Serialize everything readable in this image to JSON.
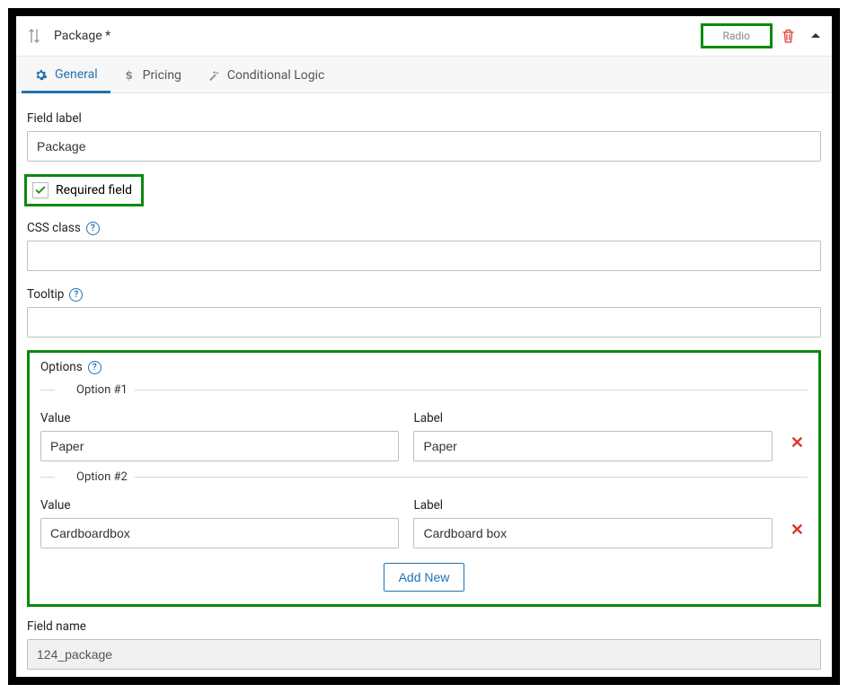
{
  "header": {
    "title": "Package *",
    "type_label": "Radio"
  },
  "tabs": {
    "general": "General",
    "pricing": "Pricing",
    "conditional": "Conditional Logic"
  },
  "general": {
    "field_label_label": "Field label",
    "field_label_value": "Package",
    "required_label": "Required field",
    "required_checked": true,
    "css_class_label": "CSS class",
    "css_class_value": "",
    "tooltip_label": "Tooltip",
    "tooltip_value": ""
  },
  "options": {
    "section_label": "Options",
    "add_new_label": "Add New",
    "value_header": "Value",
    "label_header": "Label",
    "items": [
      {
        "legend": "Option #1",
        "value": "Paper",
        "label": "Paper"
      },
      {
        "legend": "Option #2",
        "value": "Cardboardbox",
        "label": "Cardboard box"
      }
    ]
  },
  "field_name": {
    "label": "Field name",
    "value": "124_package"
  }
}
